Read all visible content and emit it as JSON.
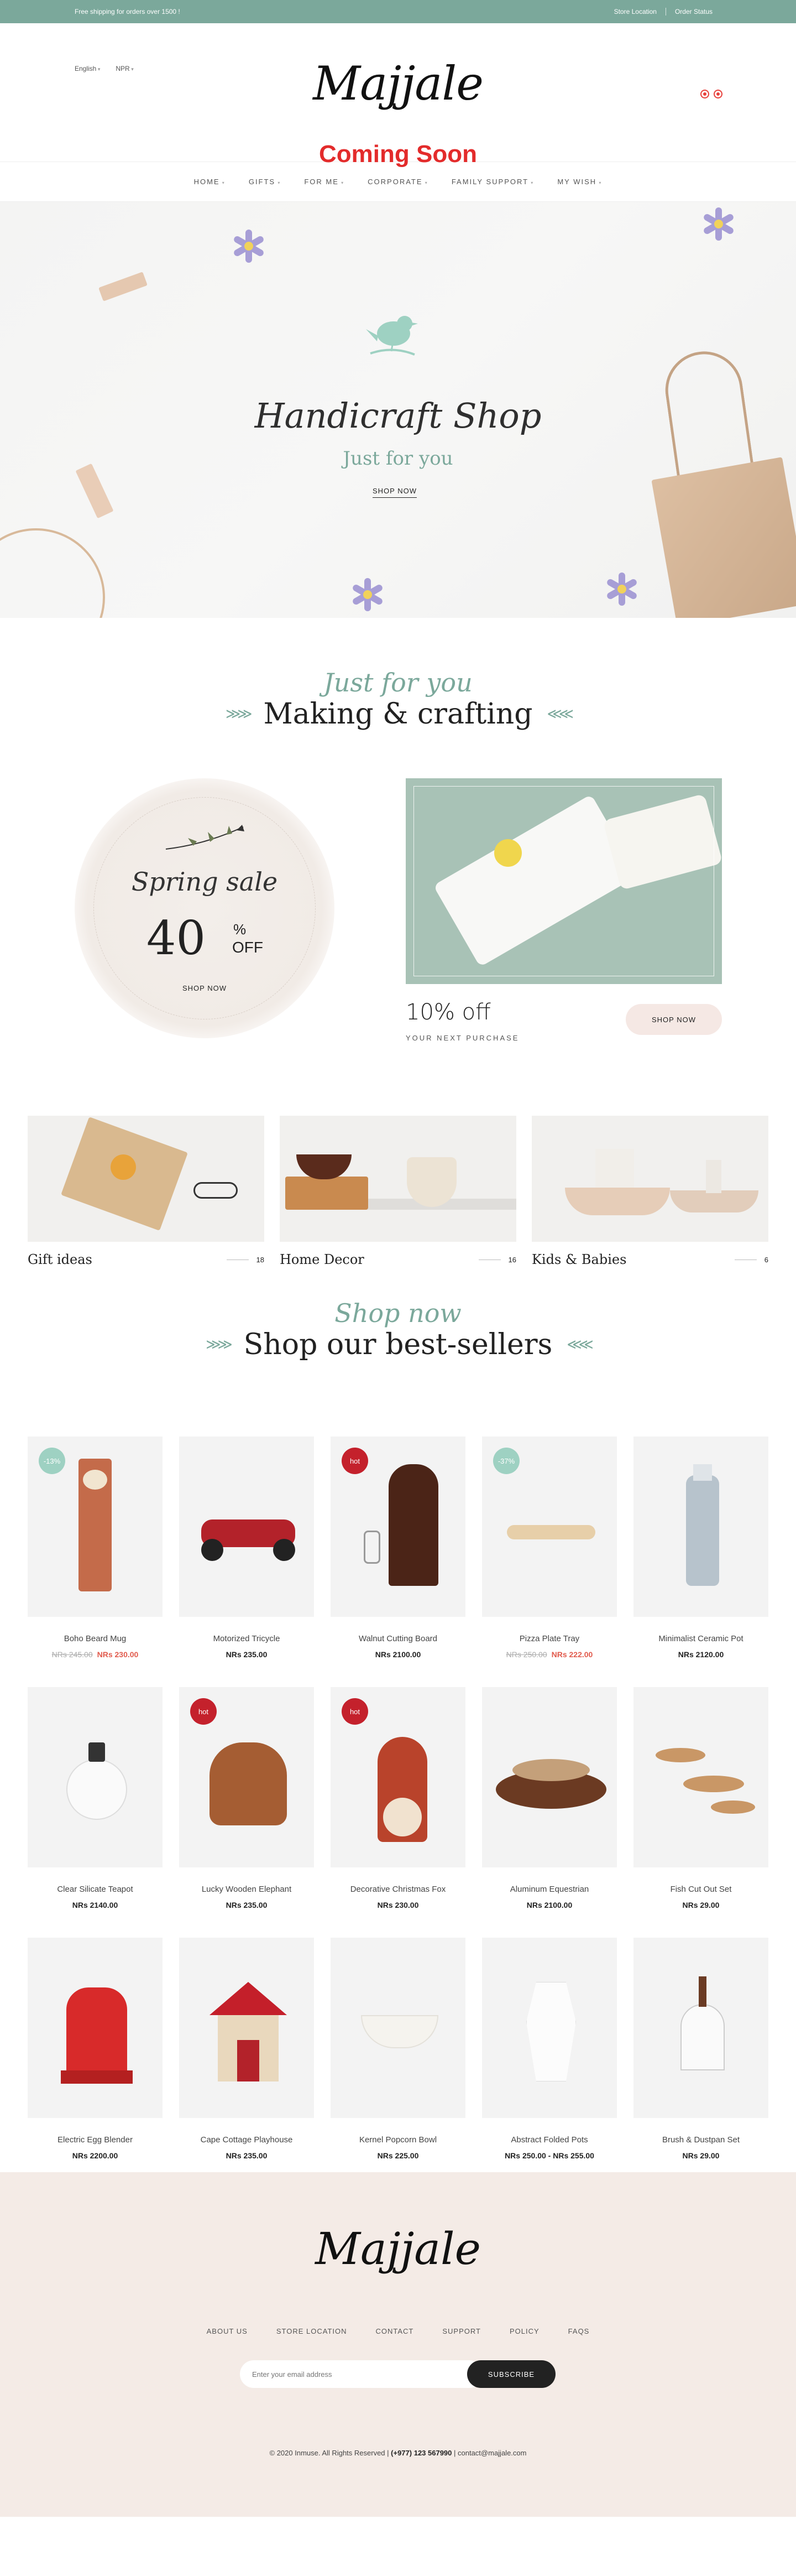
{
  "topbar": {
    "shipping": "Free shipping for orders over 1500 !",
    "store_location": "Store Location",
    "order_status": "Order Status"
  },
  "header": {
    "language": "English",
    "currency": "NPR",
    "logo": "Majjale",
    "coming_soon": "Coming Soon",
    "accent_color": "#e32b2b"
  },
  "nav": {
    "items": [
      "HOME",
      "GIFTS",
      "FOR ME",
      "CORPORATE",
      "FAMILY SUPPORT",
      "MY WISH"
    ]
  },
  "hero": {
    "title": "Handicraft Shop",
    "subtitle": "Just for you",
    "button": "SHOP NOW"
  },
  "section1": {
    "script": "Just for you",
    "title": "Making & crafting"
  },
  "promo": {
    "spring_title": "Spring sale",
    "spring_percent": "40",
    "spring_sign": "%",
    "spring_off": "OFF",
    "spring_button": "SHOP NOW",
    "offer_title": "10% off",
    "offer_subtitle": "YOUR NEXT PURCHASE",
    "offer_button": "SHOP NOW"
  },
  "categories": [
    {
      "name": "Gift ideas",
      "count": "18"
    },
    {
      "name": "Home Decor",
      "count": "16"
    },
    {
      "name": "Kids & Babies",
      "count": "6"
    }
  ],
  "section2": {
    "script": "Shop now",
    "title": "Shop our best-sellers"
  },
  "products": [
    {
      "name": "Boho Beard Mug",
      "badge": "-13%",
      "badge_type": "sale",
      "old_price": "NRs 245.00",
      "price": "NRs 230.00",
      "sale": true
    },
    {
      "name": "Motorized Tricycle",
      "badge": "",
      "badge_type": "",
      "old_price": "",
      "price": "NRs 235.00",
      "sale": false
    },
    {
      "name": "Walnut Cutting Board",
      "badge": "hot",
      "badge_type": "hot",
      "old_price": "",
      "price": "NRs 2100.00",
      "sale": false
    },
    {
      "name": "Pizza Plate Tray",
      "badge": "-37%",
      "badge_type": "sale",
      "old_price": "NRs 250.00",
      "price": "NRs 222.00",
      "sale": true
    },
    {
      "name": "Minimalist Ceramic Pot",
      "badge": "",
      "badge_type": "",
      "old_price": "",
      "price": "NRs 2120.00",
      "sale": false
    },
    {
      "name": "Clear Silicate Teapot",
      "badge": "",
      "badge_type": "",
      "old_price": "",
      "price": "NRs 2140.00",
      "sale": false
    },
    {
      "name": "Lucky Wooden Elephant",
      "badge": "hot",
      "badge_type": "hot",
      "old_price": "",
      "price": "NRs 235.00",
      "sale": false
    },
    {
      "name": "Decorative Christmas Fox",
      "badge": "hot",
      "badge_type": "hot",
      "old_price": "",
      "price": "NRs 230.00",
      "sale": false
    },
    {
      "name": "Aluminum Equestrian",
      "badge": "",
      "badge_type": "",
      "old_price": "",
      "price": "NRs 2100.00",
      "sale": false
    },
    {
      "name": "Fish Cut Out Set",
      "badge": "",
      "badge_type": "",
      "old_price": "",
      "price": "NRs 29.00",
      "sale": false
    },
    {
      "name": "Electric Egg Blender",
      "badge": "",
      "badge_type": "",
      "old_price": "",
      "price": "NRs 2200.00",
      "sale": false
    },
    {
      "name": "Cape Cottage Playhouse",
      "badge": "",
      "badge_type": "",
      "old_price": "",
      "price": "NRs 235.00",
      "sale": false
    },
    {
      "name": "Kernel Popcorn Bowl",
      "badge": "",
      "badge_type": "",
      "old_price": "",
      "price": "NRs 225.00",
      "sale": false
    },
    {
      "name": "Abstract Folded Pots",
      "badge": "",
      "badge_type": "",
      "old_price": "",
      "price": "NRs 250.00 - NRs 255.00",
      "sale": false
    },
    {
      "name": "Brush & Dustpan Set",
      "badge": "",
      "badge_type": "",
      "old_price": "",
      "price": "NRs 29.00",
      "sale": false
    }
  ],
  "footer": {
    "logo": "Majjale",
    "links": [
      "ABOUT US",
      "STORE LOCATION",
      "CONTACT",
      "SUPPORT",
      "POLICY",
      "FAQS"
    ],
    "email_placeholder": "Enter your email address",
    "subscribe": "SUBSCRIBE",
    "copyright": "© 2020 Inmuse. All Rights Reserved |",
    "phone": "(+977) 123 567990",
    "contact": "| contact@majjale.com"
  },
  "colors": {
    "topbar": "#7ba89b",
    "accent_green": "#7ba89b",
    "hot_badge": "#c4212c",
    "sale_badge": "#9ed1c2",
    "footer_bg": "#f4ebe6"
  }
}
